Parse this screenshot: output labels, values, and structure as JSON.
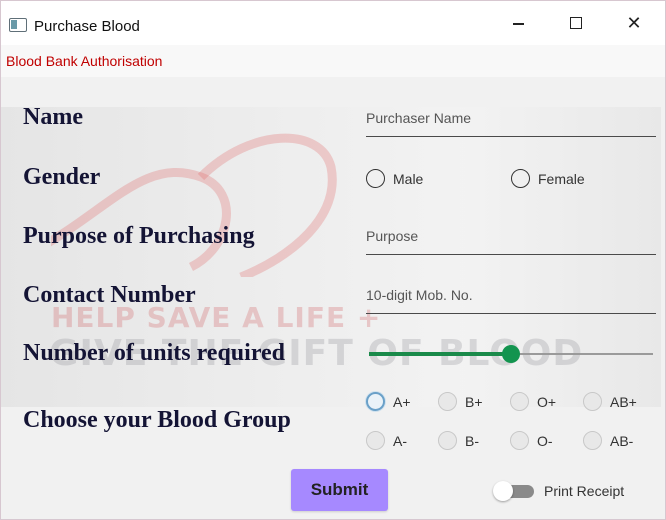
{
  "window": {
    "title": "Purchase Blood"
  },
  "menu": {
    "item": "Blood Bank Authorisation"
  },
  "background": {
    "line1": "HELP SAVE A LIFE +",
    "line2": "GIVE THE GIFT OF BLOOD"
  },
  "form": {
    "name_label": "Name",
    "name_placeholder": "Purchaser Name",
    "gender_label": "Gender",
    "gender_options": [
      "Male",
      "Female"
    ],
    "purpose_label": "Purpose of Purchasing",
    "purpose_placeholder": "Purpose",
    "contact_label": "Contact Number",
    "contact_placeholder": "10-digit Mob. No.",
    "units_label": "Number of  units required",
    "units_fraction": 0.5,
    "bloodgroup_label": "Choose your Blood Group",
    "blood_groups": [
      "A+",
      "B+",
      "O+",
      "AB+",
      "A-",
      "B-",
      "O-",
      "AB-"
    ],
    "selected_blood_group": "A+",
    "submit_label": "Submit",
    "print_receipt_label": "Print Receipt",
    "print_receipt_on": false
  },
  "colors": {
    "accent": "#a689ff",
    "slider": "#13944f",
    "menu_text": "#c00000"
  }
}
